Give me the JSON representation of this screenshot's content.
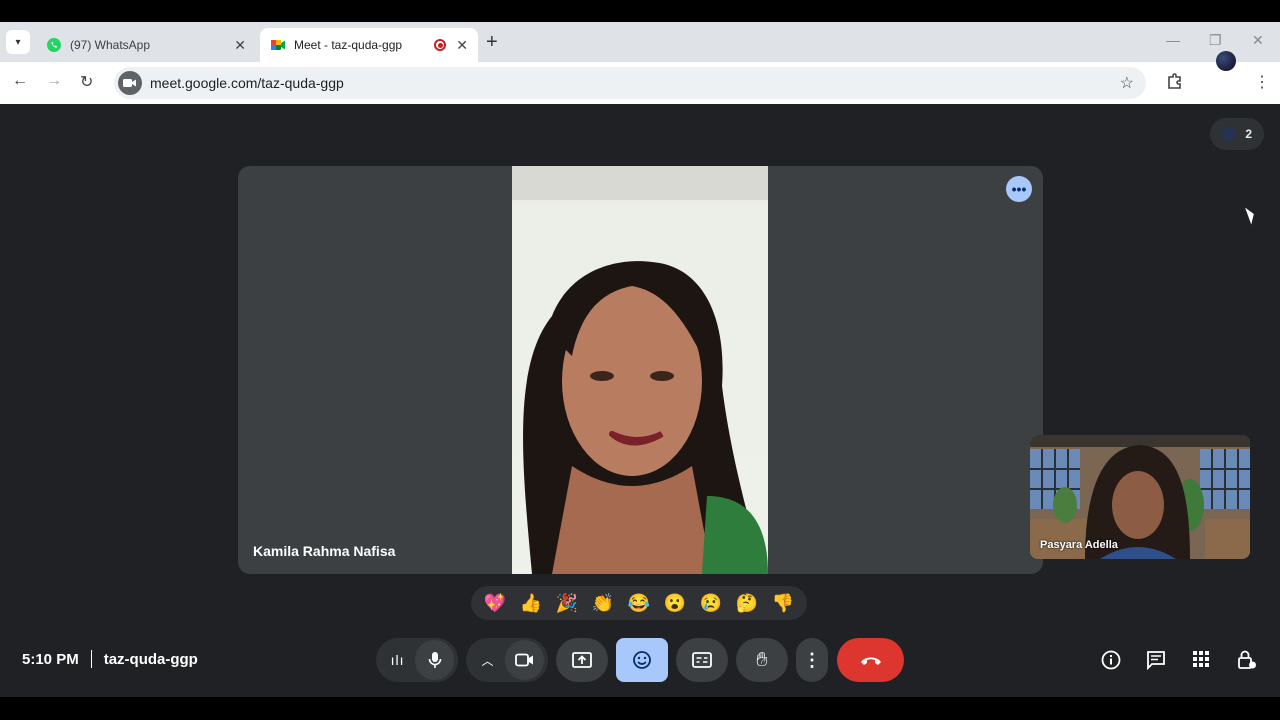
{
  "browser": {
    "tabs": [
      {
        "title": "(97) WhatsApp",
        "icon": "whatsapp-icon",
        "active": false
      },
      {
        "title": "Meet - taz-quda-ggp",
        "icon": "google-meet-icon",
        "active": true
      }
    ],
    "url": "meet.google.com/taz-quda-ggp"
  },
  "meet": {
    "participant_count": "2",
    "main_participant": "Kamila Rahma Nafisa",
    "self_participant": "Pasyara Adella",
    "reactions": [
      "💖",
      "👍",
      "🎉",
      "👏",
      "😂",
      "😮",
      "😢",
      "🤔",
      "👎"
    ],
    "time": "5:10 PM",
    "meeting_code": "taz-quda-ggp"
  },
  "colors": {
    "meet_bg": "#202124",
    "tile_bg": "#3c4043",
    "active_control": "#a8c7fa",
    "end_call": "#dc362e"
  }
}
